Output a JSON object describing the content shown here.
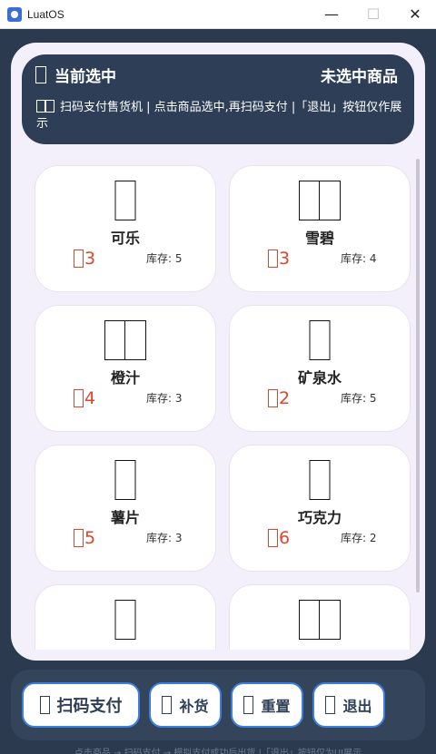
{
  "window": {
    "title": "LuatOS",
    "minimize": "—",
    "maximize": "☐",
    "close": "✕"
  },
  "header": {
    "selected_label": "当前选中",
    "selected_value": "未选中商品",
    "hint": "扫码支付售货机 | 点击商品选中,再扫码支付 |「退出」按钮仅作展示"
  },
  "products": [
    {
      "name": "可乐",
      "price": "3",
      "stock": "库存: 5"
    },
    {
      "name": "雪碧",
      "price": "3",
      "stock": "库存: 4"
    },
    {
      "name": "橙汁",
      "price": "4",
      "stock": "库存: 3"
    },
    {
      "name": "矿泉水",
      "price": "2",
      "stock": "库存: 5"
    },
    {
      "name": "薯片",
      "price": "5",
      "stock": "库存: 3"
    },
    {
      "name": "巧克力",
      "price": "6",
      "stock": "库存: 2"
    },
    {
      "name": "",
      "price": "",
      "stock": ""
    },
    {
      "name": "",
      "price": "",
      "stock": ""
    }
  ],
  "buttons": {
    "pay": "扫码支付",
    "restock": "补货",
    "reset": "重置",
    "exit": "退出"
  },
  "footer": {
    "hint": "点击商品 → 扫码支付 → 模拟支付成功后出货 |「退出」按钮仅为UI展示"
  }
}
